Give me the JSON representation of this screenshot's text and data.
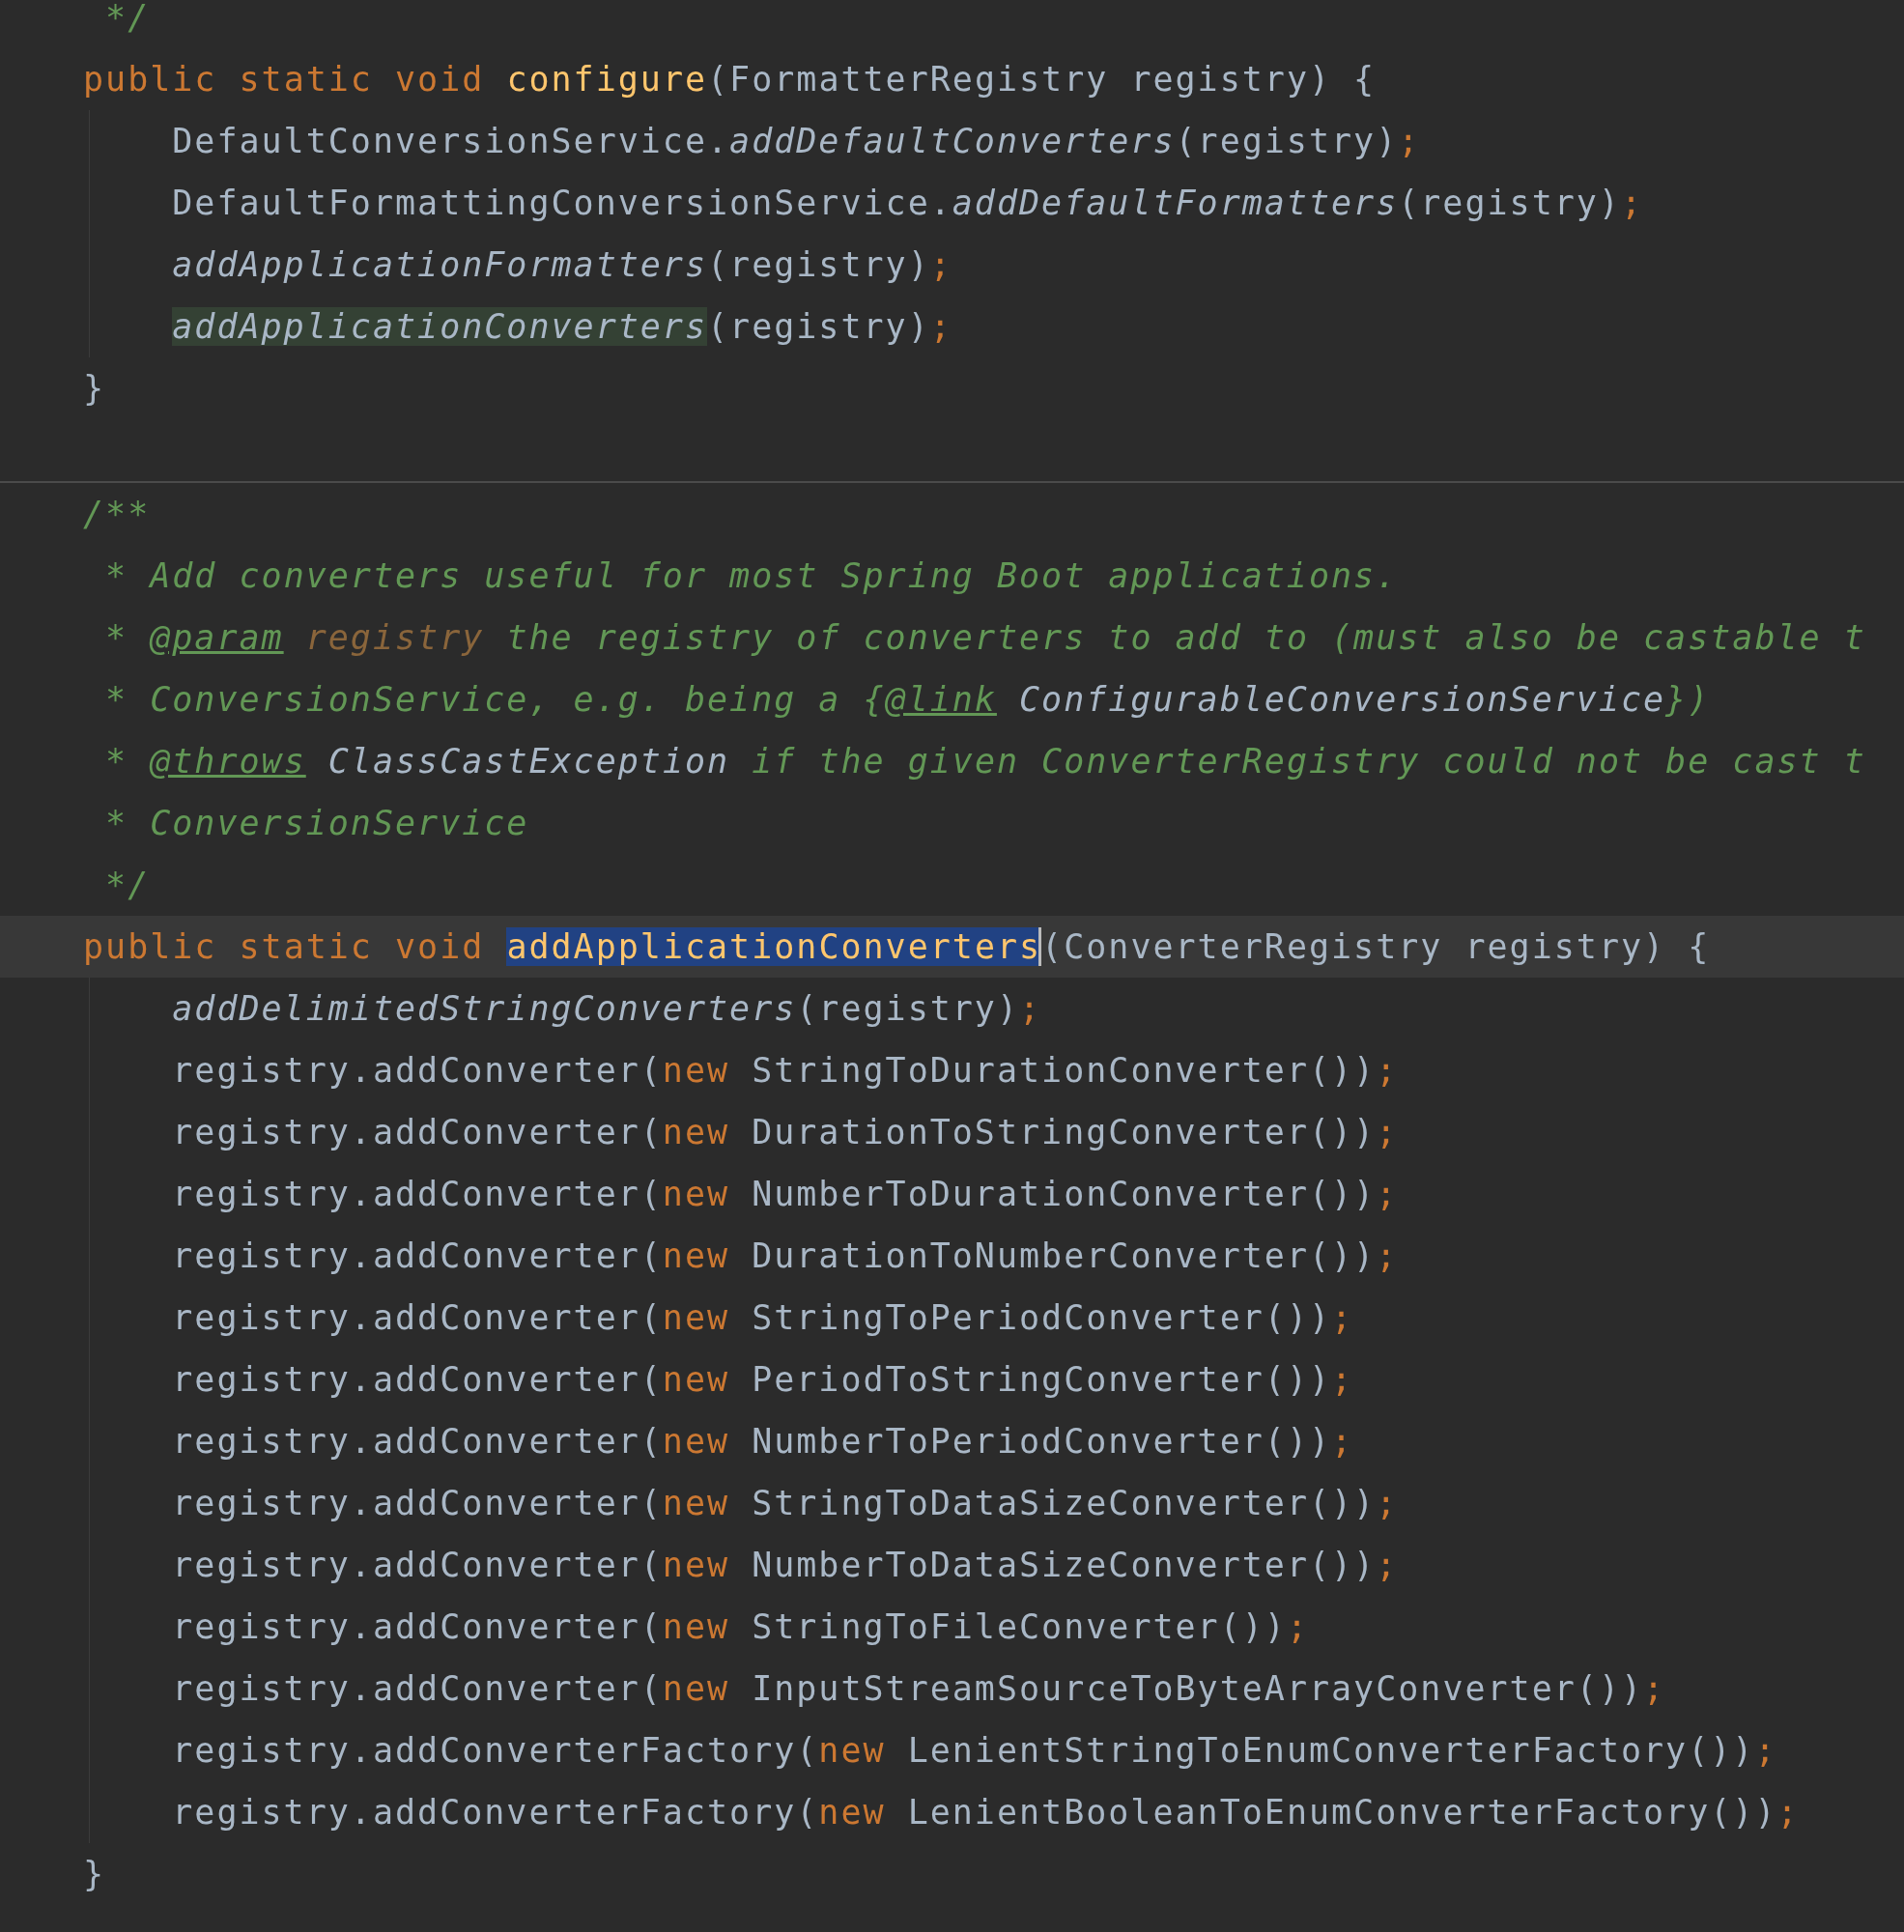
{
  "editor": {
    "lines": [
      {
        "kind": "doc",
        "current": false,
        "tokens": [
          {
            "text": "*/",
            "kind": "comment"
          }
        ]
      },
      {
        "kind": "code",
        "current": false,
        "tokens": [
          {
            "text": "public static void ",
            "kind": "keyword"
          },
          {
            "text": "configure",
            "kind": "declaration"
          },
          {
            "text": "(FormatterRegistry registry) {",
            "kind": "plain"
          }
        ]
      },
      {
        "kind": "body",
        "current": false,
        "tokens": [
          {
            "text": "DefaultConversionService.",
            "kind": "plain"
          },
          {
            "text": "addDefaultConverters",
            "kind": "static-call"
          },
          {
            "text": "(registry)",
            "kind": "plain"
          },
          {
            "text": ";",
            "kind": "semicolon"
          }
        ]
      },
      {
        "kind": "body",
        "current": false,
        "tokens": [
          {
            "text": "DefaultFormattingConversionService.",
            "kind": "plain"
          },
          {
            "text": "addDefaultFormatters",
            "kind": "static-call"
          },
          {
            "text": "(registry)",
            "kind": "plain"
          },
          {
            "text": ";",
            "kind": "semicolon"
          }
        ]
      },
      {
        "kind": "body",
        "current": false,
        "tokens": [
          {
            "text": "addApplicationFormatters",
            "kind": "static-call"
          },
          {
            "text": "(registry)",
            "kind": "plain"
          },
          {
            "text": ";",
            "kind": "semicolon"
          }
        ]
      },
      {
        "kind": "body",
        "current": false,
        "tokens": [
          {
            "text": "addApplicationConverters",
            "kind": "usage"
          },
          {
            "text": "(registry)",
            "kind": "plain"
          },
          {
            "text": ";",
            "kind": "semicolon"
          }
        ]
      },
      {
        "kind": "code",
        "current": false,
        "tokens": [
          {
            "text": "}",
            "kind": "plain"
          }
        ]
      },
      {
        "kind": "blank"
      },
      {
        "kind": "divider"
      },
      {
        "kind": "code",
        "current": false,
        "tokens": [
          {
            "text": "/**",
            "kind": "comment"
          }
        ]
      },
      {
        "kind": "doc",
        "current": false,
        "tokens": [
          {
            "text": "* Add converters useful for most Spring Boot applications.",
            "kind": "comment"
          }
        ]
      },
      {
        "kind": "doc",
        "current": false,
        "tokens": [
          {
            "text": "* ",
            "kind": "comment"
          },
          {
            "text": "@param",
            "kind": "doc-tag"
          },
          {
            "text": " registry",
            "kind": "doc-param"
          },
          {
            "text": " the registry of converters to add to (must also be castable t",
            "kind": "comment"
          }
        ]
      },
      {
        "kind": "doc",
        "current": false,
        "tokens": [
          {
            "text": "* ConversionService, e.g. being a {",
            "kind": "comment"
          },
          {
            "text": "@link",
            "kind": "doc-tag"
          },
          {
            "text": " ConfigurableConversionService",
            "kind": "doc-ref"
          },
          {
            "text": "})",
            "kind": "comment"
          }
        ]
      },
      {
        "kind": "doc",
        "current": false,
        "tokens": [
          {
            "text": "* ",
            "kind": "comment"
          },
          {
            "text": "@throws",
            "kind": "doc-tag"
          },
          {
            "text": " ClassCastException",
            "kind": "doc-ref"
          },
          {
            "text": " if the given ConverterRegistry could not be cast t",
            "kind": "comment"
          }
        ]
      },
      {
        "kind": "doc",
        "current": false,
        "tokens": [
          {
            "text": "* ConversionService",
            "kind": "comment"
          }
        ]
      },
      {
        "kind": "doc",
        "current": false,
        "tokens": [
          {
            "text": "*/",
            "kind": "comment"
          }
        ]
      },
      {
        "kind": "code",
        "current": true,
        "tokens": [
          {
            "text": "public static void ",
            "kind": "keyword"
          },
          {
            "text": "addApplicationConverters",
            "kind": "selection"
          },
          {
            "text": "(ConverterRegistry registry) {",
            "kind": "plain"
          }
        ]
      },
      {
        "kind": "body",
        "current": false,
        "tokens": [
          {
            "text": "addDelimitedStringConverters",
            "kind": "static-call"
          },
          {
            "text": "(registry)",
            "kind": "plain"
          },
          {
            "text": ";",
            "kind": "semicolon"
          }
        ]
      },
      {
        "kind": "body",
        "current": false,
        "tokens": [
          {
            "text": "registry.addConverter(",
            "kind": "plain"
          },
          {
            "text": "new ",
            "kind": "keyword"
          },
          {
            "text": "StringToDurationConverter())",
            "kind": "plain"
          },
          {
            "text": ";",
            "kind": "semicolon"
          }
        ]
      },
      {
        "kind": "body",
        "current": false,
        "tokens": [
          {
            "text": "registry.addConverter(",
            "kind": "plain"
          },
          {
            "text": "new ",
            "kind": "keyword"
          },
          {
            "text": "DurationToStringConverter())",
            "kind": "plain"
          },
          {
            "text": ";",
            "kind": "semicolon"
          }
        ]
      },
      {
        "kind": "body",
        "current": false,
        "tokens": [
          {
            "text": "registry.addConverter(",
            "kind": "plain"
          },
          {
            "text": "new ",
            "kind": "keyword"
          },
          {
            "text": "NumberToDurationConverter())",
            "kind": "plain"
          },
          {
            "text": ";",
            "kind": "semicolon"
          }
        ]
      },
      {
        "kind": "body",
        "current": false,
        "tokens": [
          {
            "text": "registry.addConverter(",
            "kind": "plain"
          },
          {
            "text": "new ",
            "kind": "keyword"
          },
          {
            "text": "DurationToNumberConverter())",
            "kind": "plain"
          },
          {
            "text": ";",
            "kind": "semicolon"
          }
        ]
      },
      {
        "kind": "body",
        "current": false,
        "tokens": [
          {
            "text": "registry.addConverter(",
            "kind": "plain"
          },
          {
            "text": "new ",
            "kind": "keyword"
          },
          {
            "text": "StringToPeriodConverter())",
            "kind": "plain"
          },
          {
            "text": ";",
            "kind": "semicolon"
          }
        ]
      },
      {
        "kind": "body",
        "current": false,
        "tokens": [
          {
            "text": "registry.addConverter(",
            "kind": "plain"
          },
          {
            "text": "new ",
            "kind": "keyword"
          },
          {
            "text": "PeriodToStringConverter())",
            "kind": "plain"
          },
          {
            "text": ";",
            "kind": "semicolon"
          }
        ]
      },
      {
        "kind": "body",
        "current": false,
        "tokens": [
          {
            "text": "registry.addConverter(",
            "kind": "plain"
          },
          {
            "text": "new ",
            "kind": "keyword"
          },
          {
            "text": "NumberToPeriodConverter())",
            "kind": "plain"
          },
          {
            "text": ";",
            "kind": "semicolon"
          }
        ]
      },
      {
        "kind": "body",
        "current": false,
        "tokens": [
          {
            "text": "registry.addConverter(",
            "kind": "plain"
          },
          {
            "text": "new ",
            "kind": "keyword"
          },
          {
            "text": "StringToDataSizeConverter())",
            "kind": "plain"
          },
          {
            "text": ";",
            "kind": "semicolon"
          }
        ]
      },
      {
        "kind": "body",
        "current": false,
        "tokens": [
          {
            "text": "registry.addConverter(",
            "kind": "plain"
          },
          {
            "text": "new ",
            "kind": "keyword"
          },
          {
            "text": "NumberToDataSizeConverter())",
            "kind": "plain"
          },
          {
            "text": ";",
            "kind": "semicolon"
          }
        ]
      },
      {
        "kind": "body",
        "current": false,
        "tokens": [
          {
            "text": "registry.addConverter(",
            "kind": "plain"
          },
          {
            "text": "new ",
            "kind": "keyword"
          },
          {
            "text": "StringToFileConverter())",
            "kind": "plain"
          },
          {
            "text": ";",
            "kind": "semicolon"
          }
        ]
      },
      {
        "kind": "body",
        "current": false,
        "tokens": [
          {
            "text": "registry.addConverter(",
            "kind": "plain"
          },
          {
            "text": "new ",
            "kind": "keyword"
          },
          {
            "text": "InputStreamSourceToByteArrayConverter())",
            "kind": "plain"
          },
          {
            "text": ";",
            "kind": "semicolon"
          }
        ]
      },
      {
        "kind": "body",
        "current": false,
        "tokens": [
          {
            "text": "registry.addConverterFactory(",
            "kind": "plain"
          },
          {
            "text": "new ",
            "kind": "keyword"
          },
          {
            "text": "LenientStringToEnumConverterFactory())",
            "kind": "plain"
          },
          {
            "text": ";",
            "kind": "semicolon"
          }
        ]
      },
      {
        "kind": "body",
        "current": false,
        "tokens": [
          {
            "text": "registry.addConverterFactory(",
            "kind": "plain"
          },
          {
            "text": "new ",
            "kind": "keyword"
          },
          {
            "text": "LenientBooleanToEnumConverterFactory())",
            "kind": "plain"
          },
          {
            "text": ";",
            "kind": "semicolon"
          }
        ]
      },
      {
        "kind": "code",
        "current": false,
        "tokens": [
          {
            "text": "}",
            "kind": "plain"
          }
        ]
      }
    ]
  }
}
